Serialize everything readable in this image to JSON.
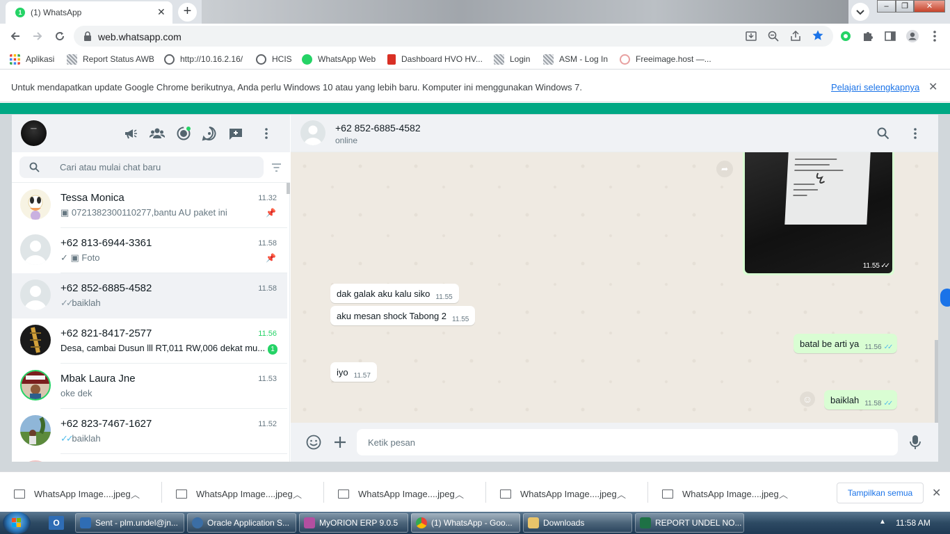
{
  "browser": {
    "tab_title": "(1) WhatsApp",
    "tab_favicon_badge": "1",
    "url": "web.whatsapp.com"
  },
  "bookmarks": [
    {
      "label": "Aplikasi",
      "icon": "apps-grid-icon",
      "color": "#ea4335"
    },
    {
      "label": "Report Status AWB",
      "icon": "broken-page-icon",
      "color": "#9aa0a6"
    },
    {
      "label": "http://10.16.2.16/",
      "icon": "globe-icon",
      "color": "#5f6368"
    },
    {
      "label": "HCIS",
      "icon": "globe-icon",
      "color": "#5f6368"
    },
    {
      "label": "WhatsApp Web",
      "icon": "whatsapp-icon",
      "color": "#25d366"
    },
    {
      "label": "Dashboard HVO HV...",
      "icon": "pdf-icon",
      "color": "#d93025"
    },
    {
      "label": "Login",
      "icon": "broken-page-icon",
      "color": "#9aa0a6"
    },
    {
      "label": "ASM - Log In",
      "icon": "broken-page-icon",
      "color": "#9aa0a6"
    },
    {
      "label": "Freeimage.host —...",
      "icon": "freeimage-icon",
      "color": "#e8a0a0"
    }
  ],
  "infobar": {
    "message": "Untuk mendapatkan update Google Chrome berikutnya, Anda perlu Windows 10 atau yang lebih baru. Komputer ini menggunakan Windows 7.",
    "link": "Pelajari selengkapnya"
  },
  "whatsapp": {
    "accent": "#00a884",
    "search_placeholder": "Cari atau mulai chat baru",
    "chats": [
      {
        "name": "Tessa Monica",
        "time": "11.32",
        "preview": "0721382300110277,bantu AU paket ini",
        "prefix_icon": "camera-icon",
        "pinned": true
      },
      {
        "name": "+62 813-6944-3361",
        "time": "11.58",
        "preview": "Foto",
        "prefix_icon": "single-tick-camera-icon",
        "pinned": true
      },
      {
        "name": "+62 852-6885-4582",
        "time": "11.58",
        "preview": "baiklah",
        "prefix_icon": "double-tick-icon",
        "active": true
      },
      {
        "name": "+62 821-8417-2577",
        "time": "11.56",
        "preview": "Desa, cambai Dusun lll  RT,011 RW,006 dekat mu...",
        "unread": "1"
      },
      {
        "name": "Mbak Laura Jne",
        "time": "11.53",
        "preview": "oke dek"
      },
      {
        "name": "+62 823-7467-1627",
        "time": "11.52",
        "preview": "baiklah",
        "prefix_icon": "double-tick-blue-icon"
      }
    ],
    "conversation": {
      "contact": "+62 852-6885-4582",
      "status": "online",
      "image_time": "11.55",
      "messages": [
        {
          "dir": "in",
          "text": "dak galak aku kalu siko",
          "time": "11.55"
        },
        {
          "dir": "in",
          "text": "aku mesan shock Tabong 2",
          "time": "11.55"
        },
        {
          "dir": "out",
          "text": "batal be arti ya",
          "time": "11.56"
        },
        {
          "dir": "in",
          "text": "iyo",
          "time": "11.57"
        },
        {
          "dir": "out",
          "text": "baiklah",
          "time": "11.58"
        }
      ],
      "input_placeholder": "Ketik pesan"
    }
  },
  "downloads": {
    "items": [
      "WhatsApp Image....jpeg",
      "WhatsApp Image....jpeg",
      "WhatsApp Image....jpeg",
      "WhatsApp Image....jpeg",
      "WhatsApp Image....jpeg"
    ],
    "show_all": "Tampilkan semua"
  },
  "taskbar": {
    "items": [
      {
        "label": "Sent - plm.undel@jn...",
        "icon": "outlook-icon",
        "color": "#2f6db5"
      },
      {
        "label": "Oracle Application S...",
        "icon": "oracle-icon",
        "color": "#3b6ea5"
      },
      {
        "label": "MyORION ERP 9.0.5",
        "icon": "orion-icon",
        "color": "#b34fa0"
      },
      {
        "label": "(1) WhatsApp - Goo...",
        "icon": "chrome-icon",
        "color": "#e2a33b",
        "active": true
      },
      {
        "label": "Downloads",
        "icon": "folder-icon",
        "color": "#e9c46a"
      },
      {
        "label": "REPORT UNDEL NO...",
        "icon": "excel-icon",
        "color": "#1e7145"
      }
    ],
    "clock": "11:58 AM"
  }
}
